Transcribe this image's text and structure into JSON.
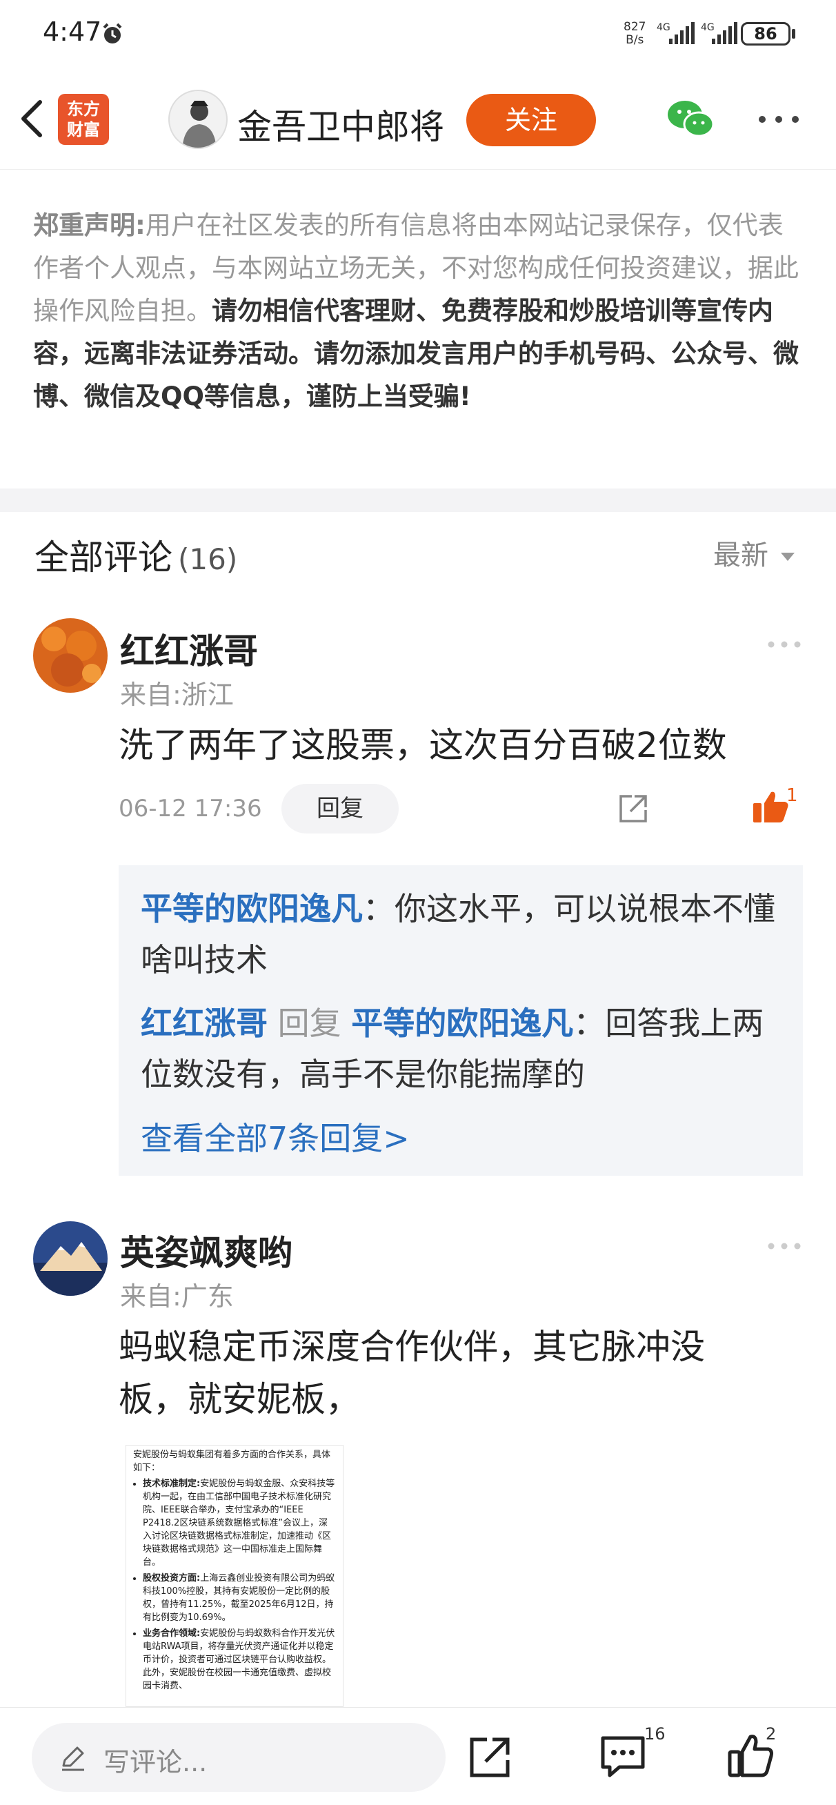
{
  "status_bar": {
    "time": "4:47",
    "net_speed_value": "827",
    "net_speed_unit": "B/s",
    "signal_label_1": "4G",
    "signal_label_2": "4G",
    "battery": "86"
  },
  "header": {
    "logo_line1": "东方",
    "logo_line2": "财富",
    "author_name": "金吾卫中郎将",
    "follow_label": "关注"
  },
  "disclaimer": {
    "title": "郑重声明:",
    "normal": "用户在社区发表的所有信息将由本网站记录保存，仅代表作者个人观点，与本网站立场无关，不对您构成任何投资建议，据此操作风险自担。",
    "strong": "请勿相信代客理财、免费荐股和炒股培训等宣传内容，远离非法证券活动。请勿添加发言用户的手机号码、公众号、微博、微信及QQ等信息，谨防上当受骗!"
  },
  "comments_section": {
    "title": "全部评论",
    "count": "(16)",
    "sort_label": "最新"
  },
  "comments": [
    {
      "name": "红红涨哥",
      "from": "来自:浙江",
      "text": "洗了两年了这股票，这次百分百破2位数",
      "time": "06-12 17:36",
      "reply_label": "回复",
      "likes": "1",
      "replies": {
        "r1_user": "平等的欧阳逸凡",
        "r1_text": "：你这水平，可以说根本不懂啥叫技术",
        "r2_user": "红红涨哥",
        "r2_mid": "回复",
        "r2_target": "平等的欧阳逸凡",
        "r2_text": "：回答我上两位数没有，高手不是你能揣摩的",
        "view_all": "查看全部7条回复>"
      }
    },
    {
      "name": "英姿飒爽哟",
      "from": "来自:广东",
      "text": "蚂蚁稳定币深度合作伙伴，其它脉冲没板，就安妮板，",
      "image": {
        "intro": "安妮股份与蚂蚁集团有着多方面的合作关系，具体如下：",
        "b1_title": "技术标准制定:",
        "b1_text": "安妮股份与蚂蚁金服、众安科技等机构一起，在由工信部中国电子技术标准化研究院、IEEE联合举办，支付宝承办的“IEEE P2418.2区块链系统数据格式标准”会议上，深入讨论区块链数据格式标准制定，加速推动《区块链数据格式规范》这一中国标准走上国际舞台。",
        "b2_title": "股权投资方面:",
        "b2_text": "上海云鑫创业投资有限公司为蚂蚁科技100%控股，其持有安妮股份一定比例的股权，曾持有11.25%，截至2025年6月12日，持有比例变为10.69%。",
        "b3_title": "业务合作领域:",
        "b3_text": "安妮股份与蚂蚁数科合作开发光伏电站RWA项目，将存量光伏资产通证化并以稳定币计价，投资者可通过区块链平台认购收益权。此外，安妮股份在校园一卡通充值缴费、虚拟校园卡消费、"
      }
    }
  ],
  "bottom_bar": {
    "placeholder": "写评论...",
    "comment_count": "16",
    "like_count": "2"
  },
  "colors": {
    "accent": "#ea5a14",
    "link": "#2a6fbf",
    "logo": "#e8542b"
  }
}
